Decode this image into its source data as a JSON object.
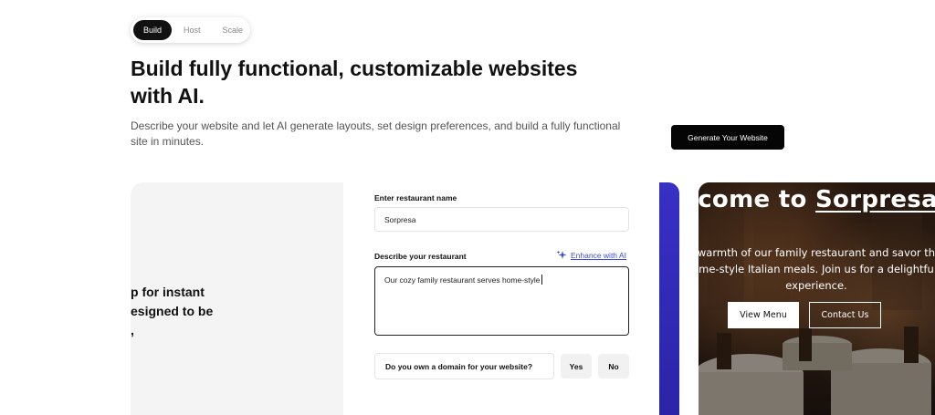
{
  "tabs": [
    {
      "label": "Build",
      "active": true
    },
    {
      "label": "Host",
      "active": false
    },
    {
      "label": "Scale",
      "active": false
    }
  ],
  "hero": {
    "title_line1": "Build fully functional, customizable websites",
    "title_line2": "with AI.",
    "desc_line1": "Describe your website and let AI generate layouts, set design preferences, and build a fully functional",
    "desc_line2": "site in minutes.",
    "cta_label": "Generate Your Website"
  },
  "left_panel": {
    "line1": "p for instant",
    "line2": "esigned to be",
    "line3": ","
  },
  "form": {
    "name_label": "Enter restaurant name",
    "name_value": "Sorpresa",
    "describe_label": "Describe your restaurant",
    "enhance_label": "Enhance with AI",
    "describe_value": "Our cozy family restaurant serves home-style",
    "domain_question": "Do you own a domain for your website?",
    "yes_label": "Yes",
    "no_label": "No"
  },
  "preview": {
    "title_prefix": "lcome to ",
    "title_name": "Sorpresa",
    "desc_line1": "warmth of our family restaurant and savor th",
    "desc_line2": "me-style Italian meals. Join us for a delightfu",
    "desc_line3": "experience.",
    "view_menu_label": "View Menu",
    "contact_label": "Contact Us"
  },
  "colors": {
    "accent_blue": "#3b4cd8",
    "strip_blue": "#3730c4",
    "cta_bg": "#050505"
  }
}
